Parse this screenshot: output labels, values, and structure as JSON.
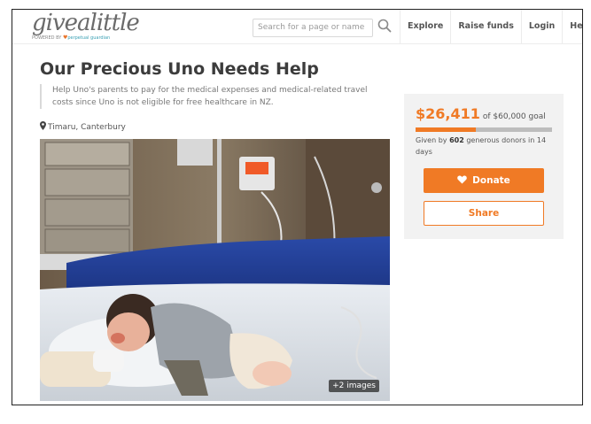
{
  "header": {
    "logo_text": "givealittle",
    "logo_sub_prefix": "POWERED BY",
    "logo_sub_brand": "perpetual guardian",
    "search_placeholder": "Search for a page or name",
    "nav": [
      "Explore",
      "Raise funds",
      "Login",
      "Help"
    ]
  },
  "page": {
    "title": "Our Precious Uno Needs Help",
    "description": "Help Uno's parents to pay for the medical expenses and medical-related travel costs since Uno is not eligible for free healthcare in NZ.",
    "location": "Timaru, Canterbury",
    "photo_badge": "+2 images"
  },
  "donation": {
    "amount": "$26,411",
    "goal_text": "of $60,000 goal",
    "progress_fraction": 0.44,
    "given_prefix": "Given by",
    "donor_count": "602",
    "given_suffix": "generous donors in 14 days",
    "donate_label": "Donate",
    "share_label": "Share"
  },
  "colors": {
    "accent": "#f07a25",
    "panel_bg": "#f2f2f2",
    "progress_track": "#bdbdbd"
  },
  "icons": {
    "search": "search-icon",
    "location": "map-pin-icon",
    "donate": "heart-icon"
  }
}
